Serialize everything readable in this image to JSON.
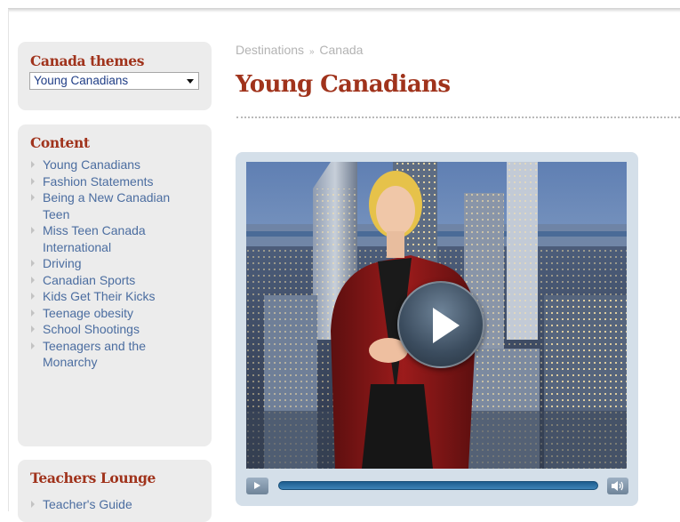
{
  "sidebar": {
    "themes": {
      "heading": "Canada themes",
      "selected": "Young Canadians"
    },
    "content": {
      "heading": "Content",
      "items": [
        "Young Canadians",
        "Fashion Statements",
        "Being a New Canadian Teen",
        "Miss Teen Canada International",
        "Driving",
        "Canadian Sports",
        "Kids Get Their Kicks",
        "Teenage obesity",
        "School Shootings",
        "Teenagers and the Monarchy"
      ]
    },
    "lounge": {
      "heading": "Teachers Lounge",
      "items": [
        "Teacher's Guide"
      ]
    }
  },
  "breadcrumb": {
    "root": "Destinations",
    "separator": "»",
    "current": "Canada"
  },
  "page_title": "Young Canadians",
  "video": {
    "play_icon": "play-icon",
    "volume_icon": "volume-icon",
    "progress": 0
  },
  "colors": {
    "heading": "#a0331c",
    "link": "#4b6da0",
    "breadcrumb": "#b3b3b3",
    "sidebar_bg": "#ececec",
    "player_frame": "#d4dfe9",
    "seek_bar": "#2f6fa2"
  }
}
